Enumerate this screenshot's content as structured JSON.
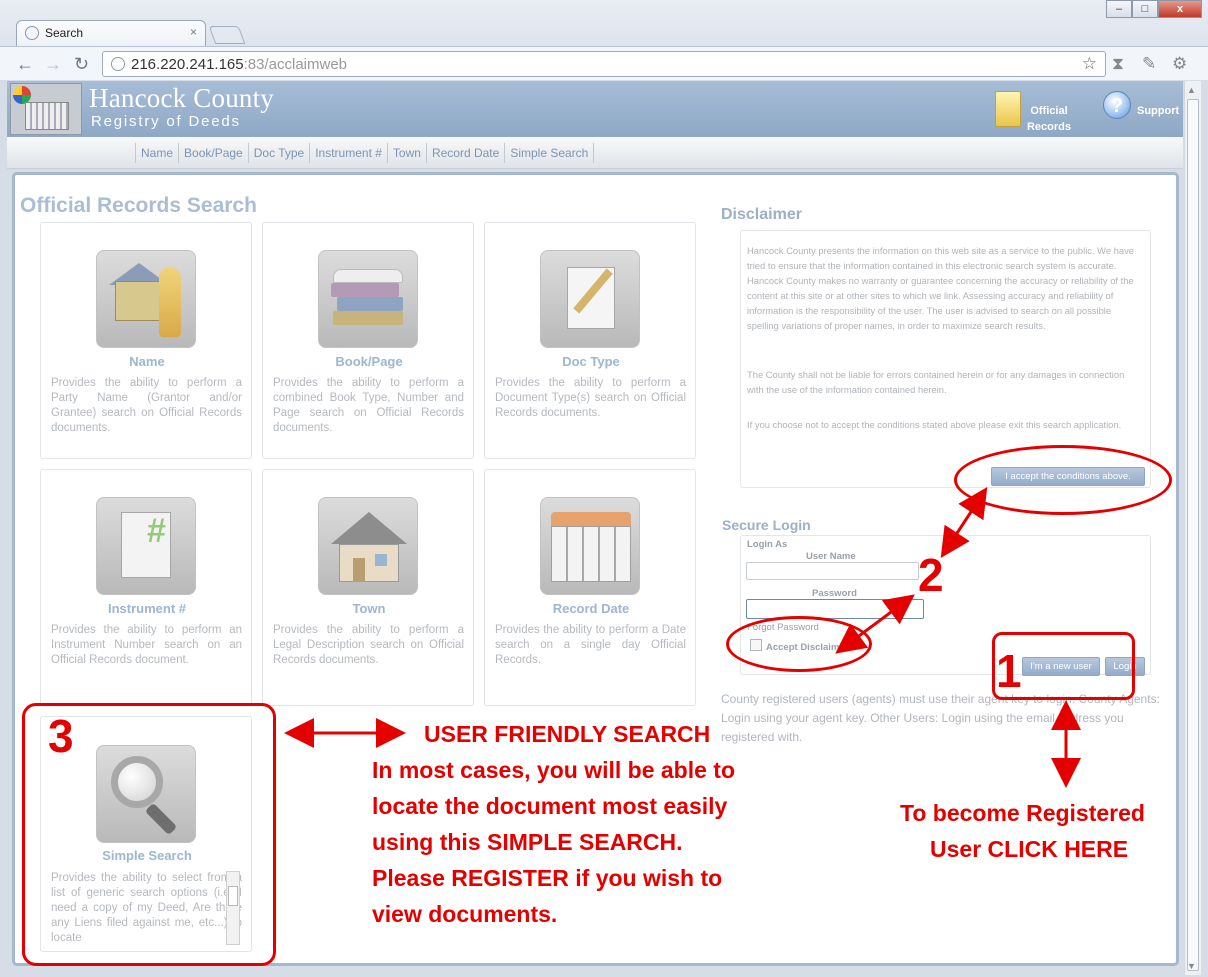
{
  "browser": {
    "tab_title": "Search",
    "tab_close": "×",
    "url_host": "216.220.241.165",
    "url_rest": ":83/acclaimweb",
    "win_min": "–",
    "win_max": "□",
    "win_close": "x"
  },
  "site": {
    "county": "Hancock County",
    "registry": "Registry of Deeds",
    "header_links": {
      "official_records": "Official Records",
      "support": "Support"
    },
    "nav": [
      "Name",
      "Book/Page",
      "Doc Type",
      "Instrument #",
      "Town",
      "Record Date",
      "Simple Search"
    ]
  },
  "main": {
    "title": "Official Records Search",
    "cards": [
      {
        "title": "Name",
        "desc": "Provides the ability to perform a Party Name (Grantor and/or Grantee) search on Official Records documents.",
        "icon": "house-person-icon"
      },
      {
        "title": "Book/Page",
        "desc": "Provides the ability to perform a combined Book Type, Number and Page search on Official Records documents.",
        "icon": "books-icon"
      },
      {
        "title": "Doc Type",
        "desc": "Provides the ability to perform a Document Type(s) search on Official Records documents.",
        "icon": "document-pen-icon"
      },
      {
        "title": "Instrument #",
        "desc": "Provides the ability to perform an Instrument Number search on an Official Records document.",
        "icon": "document-hash-icon"
      },
      {
        "title": "Town",
        "desc": "Provides the ability to perform a Legal Description search on Official Records documents.",
        "icon": "house-icon"
      },
      {
        "title": "Record Date",
        "desc": "Provides the ability to perform a Date search on a single day Official Records.",
        "icon": "calendar-icon"
      },
      {
        "title": "Simple Search",
        "desc": "Provides the ability to select from a list of generic search options (i.e. I need a copy of my Deed, Are there any Liens filed against me, etc...) to locate",
        "icon": "magnifier-icon"
      }
    ]
  },
  "disclaimer": {
    "title": "Disclaimer",
    "p1": "Hancock County presents the information on this web site as a service to the public. We have tried to ensure that the information contained in this electronic search system is accurate. Hancock County makes no warranty or guarantee concerning the accuracy or reliability of the content at this site or at other sites to which we link. Assessing accuracy and reliability of information is the responsibility of the user. The user is advised to search on all possible spelling variations of proper names, in order to maximize search results.",
    "p2": "The County shall not be liable for errors contained herein or for any damages in connection with the use of the information contained herein.",
    "p3": "If you choose not to accept the conditions stated above please exit this search application.",
    "accept_button": "I accept the conditions above."
  },
  "login": {
    "title": "Secure Login",
    "login_as": "Login As",
    "user_name": "User Name",
    "password": "Password",
    "forgot": "Forgot Password",
    "accept_disclaimer": "Accept Disclaimer",
    "new_user_button": "I'm a new user",
    "login_button": "Login",
    "note": "County registered users (agents) must use their agent key to login. County Agents: Login using your agent key. Other Users: Login using the email address you registered with."
  },
  "annotations": {
    "num1": "1",
    "num2": "2",
    "num3": "3",
    "friendly": "USER FRIENDLY SEARCH",
    "simple_lines": [
      "In most cases, you will be able to",
      "locate the document most easily",
      "using this SIMPLE SEARCH.",
      "Please REGISTER if you wish to",
      "view documents."
    ],
    "register_lines": [
      "To become Registered",
      "User CLICK HERE"
    ],
    "color": "#e50000"
  }
}
